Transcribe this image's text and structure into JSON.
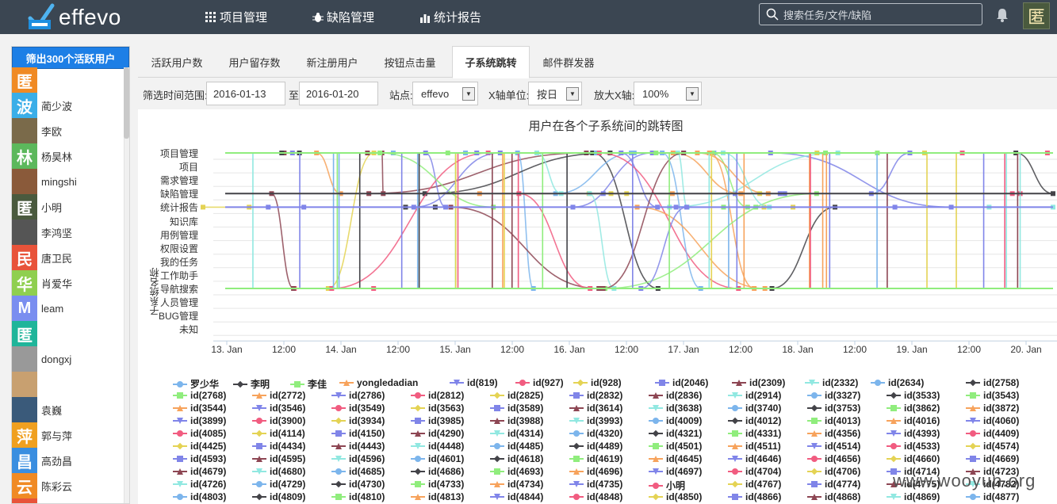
{
  "app": {
    "logo_text": "effevo"
  },
  "nav": [
    {
      "label": "项目管理",
      "icon": "grid-icon"
    },
    {
      "label": "缺陷管理",
      "icon": "bug-icon"
    },
    {
      "label": "统计报告",
      "icon": "chart-icon"
    }
  ],
  "search": {
    "placeholder": "搜索任务/文件/缺陷"
  },
  "top_avatar": {
    "text": "匿"
  },
  "sidebar": {
    "filter_button": "筛出300个活跃用户",
    "users": [
      {
        "name": "",
        "avatar_text": "匿",
        "color": "#f08a24"
      },
      {
        "name": "蔺少波",
        "avatar_text": "波",
        "color": "#3aaee8"
      },
      {
        "name": "李欧",
        "avatar_text": "",
        "color": "#7a6a4a"
      },
      {
        "name": "杨昊林",
        "avatar_text": "林",
        "color": "#5cb85c"
      },
      {
        "name": "mingshi",
        "avatar_text": "",
        "color": "#8a5a3a"
      },
      {
        "name": "小明",
        "avatar_text": "匿",
        "color": "#4a5a3e"
      },
      {
        "name": "李鸿坚",
        "avatar_text": "",
        "color": "#555"
      },
      {
        "name": "唐卫民",
        "avatar_text": "民",
        "color": "#e8533a"
      },
      {
        "name": "肖爱华",
        "avatar_text": "华",
        "color": "#8fcf4f"
      },
      {
        "name": "leam",
        "avatar_text": "M",
        "color": "#7a8ef0"
      },
      {
        "name": "",
        "avatar_text": "匿",
        "color": "#1fb59a"
      },
      {
        "name": "dongxj",
        "avatar_text": "",
        "color": "#999"
      },
      {
        "name": "",
        "avatar_text": "",
        "color": "#c8a070"
      },
      {
        "name": "袁巍",
        "avatar_text": "",
        "color": "#3a5a7a"
      },
      {
        "name": "郭与萍",
        "avatar_text": "萍",
        "color": "#f0a020"
      },
      {
        "name": "高劲昌",
        "avatar_text": "昌",
        "color": "#3a8ee0"
      },
      {
        "name": "陈彩云",
        "avatar_text": "云",
        "color": "#f08a24"
      },
      {
        "name": "",
        "avatar_text": "",
        "color": "#e8533a"
      }
    ]
  },
  "tabs": [
    {
      "label": "活跃用户数",
      "active": false
    },
    {
      "label": "用户留存数",
      "active": false
    },
    {
      "label": "新注册用户",
      "active": false
    },
    {
      "label": "按钮点击量",
      "active": false
    },
    {
      "label": "子系统跳转",
      "active": true
    },
    {
      "label": "邮件群发器",
      "active": false
    }
  ],
  "filters": {
    "range_label": "筛选时间范围:",
    "start_date": "2016-01-13",
    "to_label": "至",
    "end_date": "2016-01-20",
    "site_label": "站点:",
    "site_value": "effevo",
    "xunit_label": "X轴单位:",
    "xunit_value": "按日",
    "zoom_label": "放大X轴:",
    "zoom_value": "100%"
  },
  "chart_data": {
    "type": "line",
    "title": "用户在各个子系统间的跳转图",
    "ylabel": "子系统名称",
    "y_categories": [
      "项目管理",
      "项目",
      "需求管理",
      "缺陷管理",
      "统计报告",
      "知识库",
      "用例管理",
      "权限设置",
      "我的任务",
      "工作助手",
      "导航搜索",
      "人员管理",
      "BUG管理",
      "未知"
    ],
    "x_ticks": [
      "13. Jan",
      "12:00",
      "14. Jan",
      "12:00",
      "15. Jan",
      "12:00",
      "16. Jan",
      "12:00",
      "17. Jan",
      "12:00",
      "18. Jan",
      "12:00",
      "19. Jan",
      "12:00",
      "20. Jan"
    ],
    "legend": [
      {
        "name": "罗少华",
        "color": "#7cb5ec",
        "sym": "circle"
      },
      {
        "name": "李明",
        "color": "#434348",
        "sym": "diamond"
      },
      {
        "name": "李佳",
        "color": "#90ed7d",
        "sym": "square"
      },
      {
        "name": "yongledadian",
        "color": "#f7a35c",
        "sym": "tri"
      },
      {
        "name": "id(819)",
        "color": "#8085e9",
        "sym": "tridown"
      },
      {
        "name": "id(927)",
        "color": "#f15c80",
        "sym": "circle"
      },
      {
        "name": "id(928)",
        "color": "#e4d354",
        "sym": "diamond"
      },
      {
        "name": "id(2046)",
        "color": "#8085e8",
        "sym": "square"
      },
      {
        "name": "id(2309)",
        "color": "#8d4653",
        "sym": "tri"
      },
      {
        "name": "id(2332)",
        "color": "#91e8e1",
        "sym": "tridown"
      },
      {
        "name": "id(2634)",
        "color": "#7cb5ec",
        "sym": "circle"
      },
      {
        "name": "id(2758)",
        "color": "#434348",
        "sym": "diamond"
      },
      {
        "name": "id(2768)",
        "color": "#90ed7d",
        "sym": "square"
      },
      {
        "name": "id(2772)",
        "color": "#f7a35c",
        "sym": "tri"
      },
      {
        "name": "id(2786)",
        "color": "#8085e9",
        "sym": "tridown"
      },
      {
        "name": "id(2812)",
        "color": "#f15c80",
        "sym": "circle"
      },
      {
        "name": "id(2825)",
        "color": "#e4d354",
        "sym": "diamond"
      },
      {
        "name": "id(2832)",
        "color": "#8085e8",
        "sym": "square"
      },
      {
        "name": "id(2836)",
        "color": "#8d4653",
        "sym": "tri"
      },
      {
        "name": "id(2914)",
        "color": "#91e8e1",
        "sym": "tridown"
      },
      {
        "name": "id(3327)",
        "color": "#7cb5ec",
        "sym": "circle"
      },
      {
        "name": "id(3533)",
        "color": "#434348",
        "sym": "diamond"
      },
      {
        "name": "id(3543)",
        "color": "#90ed7d",
        "sym": "square"
      },
      {
        "name": "id(3544)",
        "color": "#f7a35c",
        "sym": "tri"
      },
      {
        "name": "id(3546)",
        "color": "#8085e9",
        "sym": "tridown"
      },
      {
        "name": "id(3549)",
        "color": "#f15c80",
        "sym": "circle"
      },
      {
        "name": "id(3563)",
        "color": "#e4d354",
        "sym": "diamond"
      },
      {
        "name": "id(3589)",
        "color": "#8085e8",
        "sym": "square"
      },
      {
        "name": "id(3614)",
        "color": "#8d4653",
        "sym": "tri"
      },
      {
        "name": "id(3638)",
        "color": "#91e8e1",
        "sym": "tridown"
      },
      {
        "name": "id(3740)",
        "color": "#7cb5ec",
        "sym": "circle"
      },
      {
        "name": "id(3753)",
        "color": "#434348",
        "sym": "diamond"
      },
      {
        "name": "id(3862)",
        "color": "#90ed7d",
        "sym": "square"
      },
      {
        "name": "id(3872)",
        "color": "#f7a35c",
        "sym": "tri"
      },
      {
        "name": "id(3899)",
        "color": "#8085e9",
        "sym": "tridown"
      },
      {
        "name": "id(3900)",
        "color": "#f15c80",
        "sym": "circle"
      },
      {
        "name": "id(3934)",
        "color": "#e4d354",
        "sym": "diamond"
      },
      {
        "name": "id(3985)",
        "color": "#8085e8",
        "sym": "square"
      },
      {
        "name": "id(3988)",
        "color": "#8d4653",
        "sym": "tri"
      },
      {
        "name": "id(3993)",
        "color": "#91e8e1",
        "sym": "tridown"
      },
      {
        "name": "id(4009)",
        "color": "#7cb5ec",
        "sym": "circle"
      },
      {
        "name": "id(4012)",
        "color": "#434348",
        "sym": "diamond"
      },
      {
        "name": "id(4013)",
        "color": "#90ed7d",
        "sym": "square"
      },
      {
        "name": "id(4016)",
        "color": "#f7a35c",
        "sym": "tri"
      },
      {
        "name": "id(4060)",
        "color": "#8085e9",
        "sym": "tridown"
      },
      {
        "name": "id(4085)",
        "color": "#f15c80",
        "sym": "circle"
      },
      {
        "name": "id(4114)",
        "color": "#e4d354",
        "sym": "diamond"
      },
      {
        "name": "id(4150)",
        "color": "#8085e8",
        "sym": "square"
      },
      {
        "name": "id(4290)",
        "color": "#8d4653",
        "sym": "tri"
      },
      {
        "name": "id(4314)",
        "color": "#91e8e1",
        "sym": "tridown"
      },
      {
        "name": "id(4320)",
        "color": "#7cb5ec",
        "sym": "circle"
      },
      {
        "name": "id(4321)",
        "color": "#434348",
        "sym": "diamond"
      },
      {
        "name": "id(4331)",
        "color": "#90ed7d",
        "sym": "square"
      },
      {
        "name": "id(4356)",
        "color": "#f7a35c",
        "sym": "tri"
      },
      {
        "name": "id(4393)",
        "color": "#8085e9",
        "sym": "tridown"
      },
      {
        "name": "id(4409)",
        "color": "#f15c80",
        "sym": "circle"
      },
      {
        "name": "id(4425)",
        "color": "#e4d354",
        "sym": "diamond"
      },
      {
        "name": "id(4434)",
        "color": "#8085e8",
        "sym": "square"
      },
      {
        "name": "id(4443)",
        "color": "#8d4653",
        "sym": "tri"
      },
      {
        "name": "id(4448)",
        "color": "#91e8e1",
        "sym": "tridown"
      },
      {
        "name": "id(4485)",
        "color": "#7cb5ec",
        "sym": "circle"
      },
      {
        "name": "id(4489)",
        "color": "#434348",
        "sym": "diamond"
      },
      {
        "name": "id(4501)",
        "color": "#90ed7d",
        "sym": "square"
      },
      {
        "name": "id(4511)",
        "color": "#f7a35c",
        "sym": "tri"
      },
      {
        "name": "id(4514)",
        "color": "#8085e9",
        "sym": "tridown"
      },
      {
        "name": "id(4533)",
        "color": "#f15c80",
        "sym": "circle"
      },
      {
        "name": "id(4574)",
        "color": "#e4d354",
        "sym": "diamond"
      },
      {
        "name": "id(4593)",
        "color": "#8085e8",
        "sym": "square"
      },
      {
        "name": "id(4595)",
        "color": "#8d4653",
        "sym": "tri"
      },
      {
        "name": "id(4596)",
        "color": "#91e8e1",
        "sym": "tridown"
      },
      {
        "name": "id(4601)",
        "color": "#7cb5ec",
        "sym": "circle"
      },
      {
        "name": "id(4618)",
        "color": "#434348",
        "sym": "diamond"
      },
      {
        "name": "id(4619)",
        "color": "#90ed7d",
        "sym": "square"
      },
      {
        "name": "id(4645)",
        "color": "#f7a35c",
        "sym": "tri"
      },
      {
        "name": "id(4646)",
        "color": "#8085e9",
        "sym": "tridown"
      },
      {
        "name": "id(4656)",
        "color": "#f15c80",
        "sym": "circle"
      },
      {
        "name": "id(4660)",
        "color": "#e4d354",
        "sym": "diamond"
      },
      {
        "name": "id(4669)",
        "color": "#8085e8",
        "sym": "square"
      },
      {
        "name": "id(4679)",
        "color": "#8d4653",
        "sym": "tri"
      },
      {
        "name": "id(4680)",
        "color": "#91e8e1",
        "sym": "tridown"
      },
      {
        "name": "id(4685)",
        "color": "#7cb5ec",
        "sym": "circle"
      },
      {
        "name": "id(4686)",
        "color": "#434348",
        "sym": "diamond"
      },
      {
        "name": "id(4693)",
        "color": "#90ed7d",
        "sym": "square"
      },
      {
        "name": "id(4696)",
        "color": "#f7a35c",
        "sym": "tri"
      },
      {
        "name": "id(4697)",
        "color": "#8085e9",
        "sym": "tridown"
      },
      {
        "name": "id(4704)",
        "color": "#f15c80",
        "sym": "circle"
      },
      {
        "name": "id(4706)",
        "color": "#e4d354",
        "sym": "diamond"
      },
      {
        "name": "id(4714)",
        "color": "#8085e8",
        "sym": "square"
      },
      {
        "name": "id(4723)",
        "color": "#8d4653",
        "sym": "tri"
      },
      {
        "name": "id(4726)",
        "color": "#91e8e1",
        "sym": "tridown"
      },
      {
        "name": "id(4729)",
        "color": "#7cb5ec",
        "sym": "circle"
      },
      {
        "name": "id(4730)",
        "color": "#434348",
        "sym": "diamond"
      },
      {
        "name": "id(4733)",
        "color": "#90ed7d",
        "sym": "square"
      },
      {
        "name": "id(4734)",
        "color": "#f7a35c",
        "sym": "tri"
      },
      {
        "name": "id(4735)",
        "color": "#8085e9",
        "sym": "tridown"
      },
      {
        "name": "小明",
        "color": "#f15c80",
        "sym": "circle"
      },
      {
        "name": "id(4767)",
        "color": "#e4d354",
        "sym": "diamond"
      },
      {
        "name": "id(4774)",
        "color": "#8085e8",
        "sym": "square"
      },
      {
        "name": "id(4775)",
        "color": "#8d4653",
        "sym": "tri"
      },
      {
        "name": "id(4782)",
        "color": "#91e8e1",
        "sym": "tridown"
      },
      {
        "name": "id(4803)",
        "color": "#7cb5ec",
        "sym": "circle"
      },
      {
        "name": "id(4809)",
        "color": "#434348",
        "sym": "diamond"
      },
      {
        "name": "id(4810)",
        "color": "#90ed7d",
        "sym": "square"
      },
      {
        "name": "id(4813)",
        "color": "#f7a35c",
        "sym": "tri"
      },
      {
        "name": "id(4844)",
        "color": "#8085e9",
        "sym": "tridown"
      },
      {
        "name": "id(4848)",
        "color": "#f15c80",
        "sym": "circle"
      },
      {
        "name": "id(4850)",
        "color": "#e4d354",
        "sym": "diamond"
      },
      {
        "name": "id(4866)",
        "color": "#8085e8",
        "sym": "square"
      },
      {
        "name": "id(4868)",
        "color": "#8d4653",
        "sym": "tri"
      },
      {
        "name": "id(4869)",
        "color": "#91e8e1",
        "sym": "tridown"
      },
      {
        "name": "id(4877)",
        "color": "#7cb5ec",
        "sym": "circle"
      }
    ]
  },
  "watermark": "www.wooyun.org"
}
